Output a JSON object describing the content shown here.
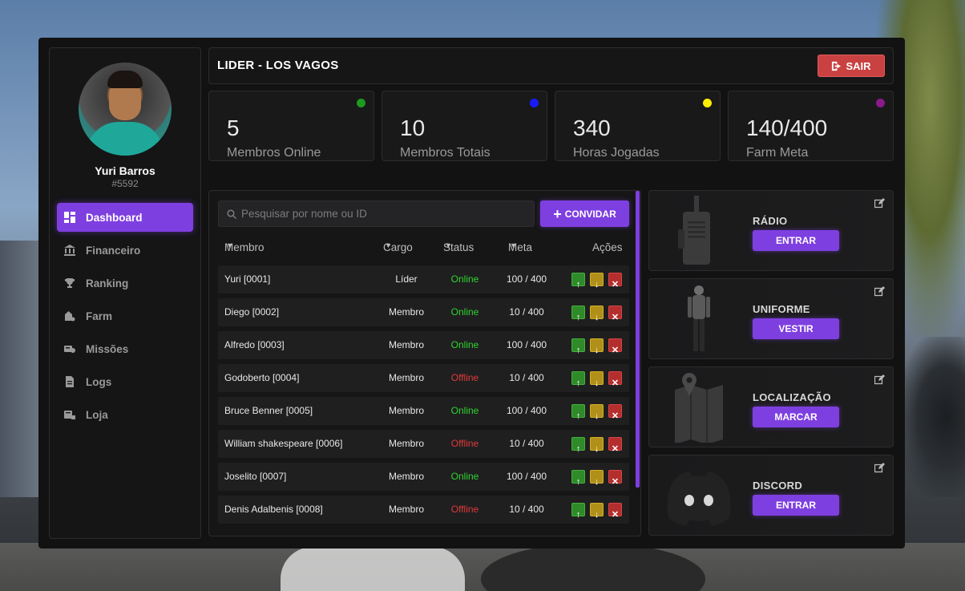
{
  "header": {
    "title": "LIDER - LOS VAGOS",
    "logout_label": "SAIR"
  },
  "user": {
    "name": "Yuri Barros",
    "id": "#5592"
  },
  "sidebar": {
    "items": [
      {
        "label": "Dashboard",
        "icon": "dashboard-icon",
        "active": true
      },
      {
        "label": "Financeiro",
        "icon": "bank-icon"
      },
      {
        "label": "Ranking",
        "icon": "trophy-icon"
      },
      {
        "label": "Farm",
        "icon": "farm-icon"
      },
      {
        "label": "Missões",
        "icon": "missions-icon"
      },
      {
        "label": "Logs",
        "icon": "logs-icon"
      },
      {
        "label": "Loja",
        "icon": "shop-icon"
      }
    ]
  },
  "stats": [
    {
      "value": "5",
      "label": "Membros Online",
      "dot_color": "#1c9b1c"
    },
    {
      "value": "10",
      "label": "Membros Totais",
      "dot_color": "#1a1aff"
    },
    {
      "value": "340",
      "label": "Horas Jogadas",
      "dot_color": "#ffee00"
    },
    {
      "value": "140/400",
      "label": "Farm Meta",
      "dot_color": "#8b1a8b"
    }
  ],
  "members": {
    "search_placeholder": "Pesquisar por nome ou ID",
    "invite_label": "CONVIDAR",
    "columns": {
      "member": "Membro",
      "cargo": "Cargo",
      "status": "Status",
      "meta": "Meta",
      "actions": "Ações"
    },
    "rows": [
      {
        "name": "Yuri [0001]",
        "cargo": "Líder",
        "status": "Online",
        "meta": "100 / 400"
      },
      {
        "name": "Diego [0002]",
        "cargo": "Membro",
        "status": "Online",
        "meta": "10 / 400"
      },
      {
        "name": "Alfredo [0003]",
        "cargo": "Membro",
        "status": "Online",
        "meta": "100 / 400"
      },
      {
        "name": "Godoberto [0004]",
        "cargo": "Membro",
        "status": "Offline",
        "meta": "10 / 400"
      },
      {
        "name": "Bruce Benner [0005]",
        "cargo": "Membro",
        "status": "Online",
        "meta": "100 / 400"
      },
      {
        "name": "William shakespeare [0006]",
        "cargo": "Membro",
        "status": "Offline",
        "meta": "10 / 400"
      },
      {
        "name": "Joselito [0007]",
        "cargo": "Membro",
        "status": "Online",
        "meta": "100 / 400"
      },
      {
        "name": "Denis Adalbenis [0008]",
        "cargo": "Membro",
        "status": "Offline",
        "meta": "10 / 400"
      }
    ]
  },
  "cards": [
    {
      "title": "RÁDIO",
      "button": "ENTRAR",
      "icon": "radio-icon"
    },
    {
      "title": "UNIFORME",
      "button": "VESTIR",
      "icon": "uniform-icon"
    },
    {
      "title": "LOCALIZAÇÃO",
      "button": "MARCAR",
      "icon": "map-pin-icon"
    },
    {
      "title": "DISCORD",
      "button": "ENTRAR",
      "icon": "discord-icon"
    }
  ],
  "colors": {
    "accent": "#7e3fe0",
    "online": "#2fd42f",
    "offline": "#e03a3a",
    "logout": "#c94141"
  }
}
